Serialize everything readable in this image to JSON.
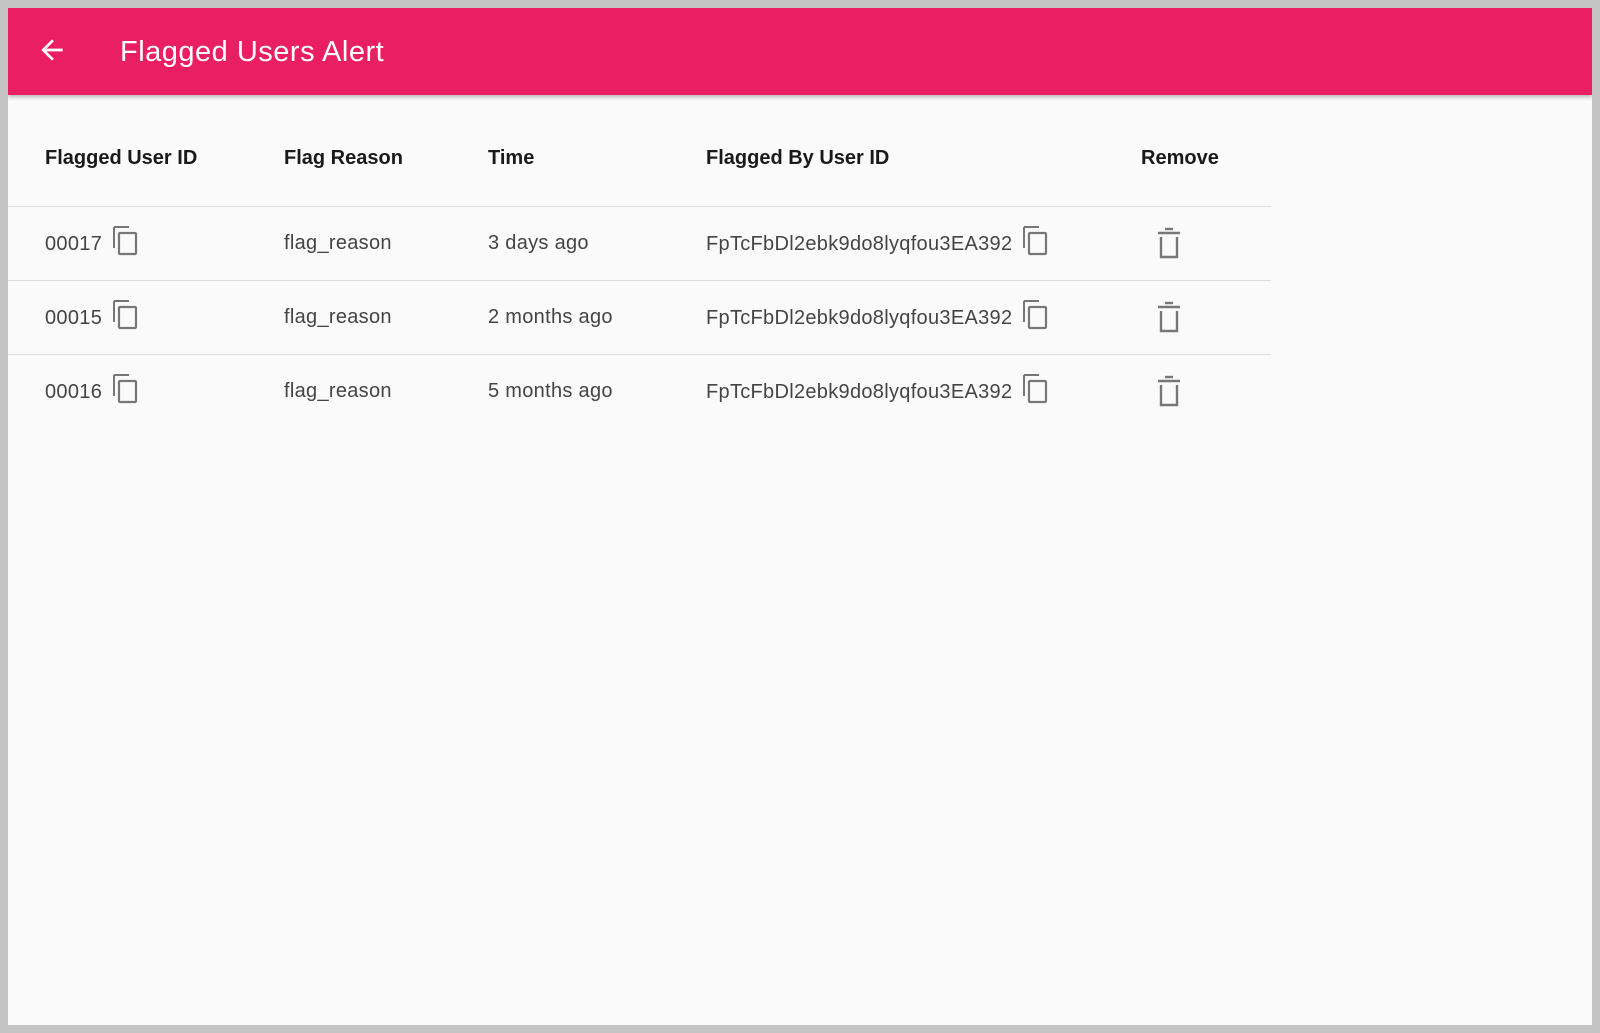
{
  "appbar": {
    "title": "Flagged Users Alert",
    "back_icon": "arrow-left-icon",
    "color": "#e91e63"
  },
  "table": {
    "headers": {
      "flagged_user_id": "Flagged User ID",
      "flag_reason": "Flag Reason",
      "time": "Time",
      "flagged_by_user_id": "Flagged By User ID",
      "remove": "Remove"
    },
    "rows": [
      {
        "flagged_user_id": "00017",
        "flag_reason": "flag_reason",
        "time": "3 days ago",
        "flagged_by_user_id": "FpTcFbDl2ebk9do8lyqfou3EA392"
      },
      {
        "flagged_user_id": "00015",
        "flag_reason": "flag_reason",
        "time": "2 months ago",
        "flagged_by_user_id": "FpTcFbDl2ebk9do8lyqfou3EA392"
      },
      {
        "flagged_user_id": "00016",
        "flag_reason": "flag_reason",
        "time": "5 months ago",
        "flagged_by_user_id": "FpTcFbDl2ebk9do8lyqfou3EA392"
      }
    ],
    "copy_icon": "copy-icon",
    "remove_icon": "trash-icon"
  }
}
